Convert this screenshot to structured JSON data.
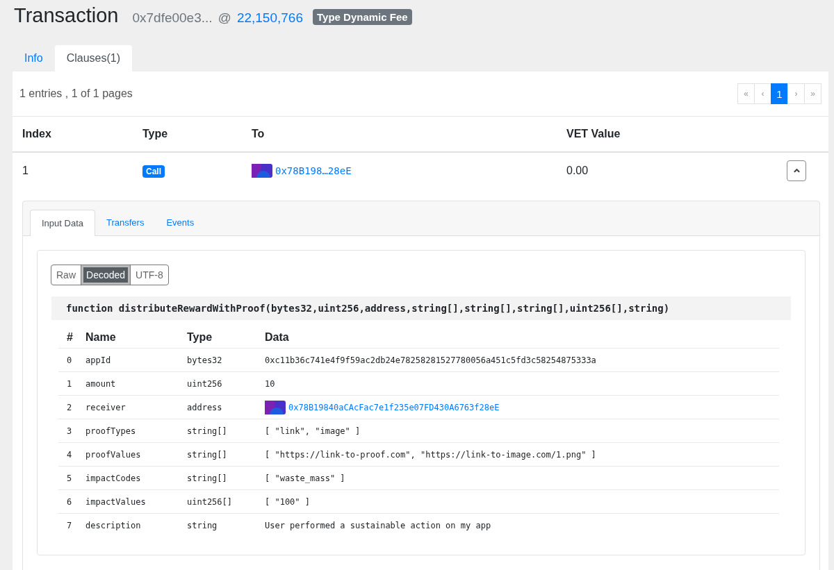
{
  "header": {
    "title": "Transaction",
    "hash": "0x7dfe00e3...",
    "at": "@",
    "block": "22,150,766",
    "badge": "Type Dynamic Fee"
  },
  "tabs": [
    {
      "label": "Info",
      "selected": false
    },
    {
      "label": "Clauses(1)",
      "selected": true
    }
  ],
  "summary": "1 entries , 1 of 1 pages",
  "pagination": [
    {
      "label": "«",
      "selected": false
    },
    {
      "label": "‹",
      "selected": false
    },
    {
      "label": "1",
      "selected": true
    },
    {
      "label": "›",
      "selected": false
    },
    {
      "label": "»",
      "selected": false
    }
  ],
  "clauses": {
    "columns": [
      "Index",
      "Type",
      "To",
      "VET Value"
    ],
    "rows": [
      {
        "index": "1",
        "type": "Call",
        "to": "0x78B198…28eE",
        "value": "0.00",
        "expanded": true
      }
    ]
  },
  "detail_tabs": [
    {
      "label": "Input Data",
      "selected": true
    },
    {
      "label": "Transfers",
      "selected": false
    },
    {
      "label": "Events",
      "selected": false
    }
  ],
  "formats": [
    {
      "label": "Raw",
      "selected": false
    },
    {
      "label": "Decoded",
      "selected": true
    },
    {
      "label": "UTF-8",
      "selected": false
    }
  ],
  "function": "function distributeRewardWithProof(bytes32,uint256,address,string[],string[],string[],uint256[],string)",
  "params": {
    "columns": [
      "#",
      "Name",
      "Type",
      "Data"
    ],
    "rows": [
      {
        "index": "0",
        "name": "appId",
        "type": "bytes32",
        "kind": "text",
        "data": "0xc11b36c741e4f9f59ac2db24e78258281527780056a451c5fd3c58254875333a"
      },
      {
        "index": "1",
        "name": "amount",
        "type": "uint256",
        "kind": "text",
        "data": "10"
      },
      {
        "index": "2",
        "name": "receiver",
        "type": "address",
        "kind": "address",
        "data": "0x78B19840aCAcFac7e1f235e07FD430A6763f28eE"
      },
      {
        "index": "3",
        "name": "proofTypes",
        "type": "string[]",
        "kind": "text",
        "data": "[ \"link\", \"image\" ]"
      },
      {
        "index": "4",
        "name": "proofValues",
        "type": "string[]",
        "kind": "text",
        "data": "[ \"https://link-to-proof.com\", \"https://link-to-image.com/1.png\" ]"
      },
      {
        "index": "5",
        "name": "impactCodes",
        "type": "string[]",
        "kind": "text",
        "data": "[ \"waste_mass\" ]"
      },
      {
        "index": "6",
        "name": "impactValues",
        "type": "uint256[]",
        "kind": "text",
        "data": "[ \"100\" ]"
      },
      {
        "index": "7",
        "name": "description",
        "type": "string",
        "kind": "text",
        "data": "User performed a sustainable action on my app"
      }
    ]
  }
}
